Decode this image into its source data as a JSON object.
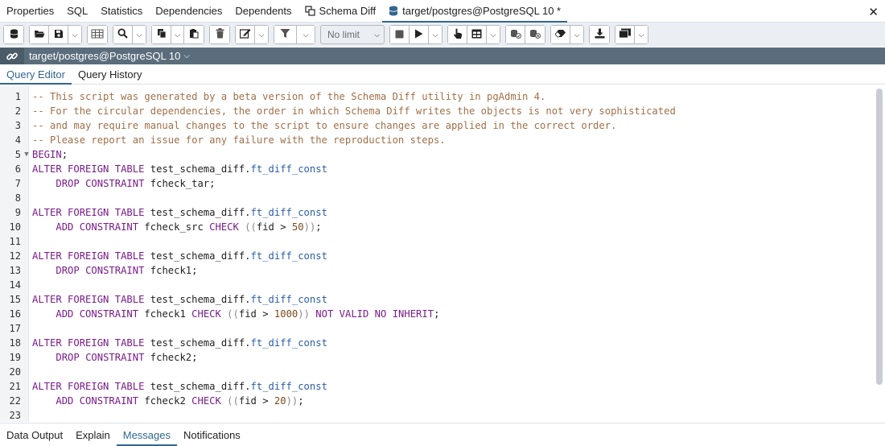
{
  "tabs": [
    {
      "label": "Properties"
    },
    {
      "label": "SQL"
    },
    {
      "label": "Statistics"
    },
    {
      "label": "Dependencies"
    },
    {
      "label": "Dependents"
    },
    {
      "label": "Schema Diff",
      "icon": "schema-diff-icon"
    },
    {
      "label": "target/postgres@PostgreSQL 10 *",
      "icon": "database-icon",
      "active": true
    }
  ],
  "close_glyph": "✕",
  "toolbar": {
    "limit_select": {
      "value": "No limit"
    }
  },
  "connection": {
    "label": "target/postgres@PostgreSQL 10",
    "icon": "connection-icon"
  },
  "subtabs": [
    {
      "label": "Query Editor",
      "active": true
    },
    {
      "label": "Query History"
    }
  ],
  "editor": {
    "lines": [
      {
        "n": "1",
        "text": "-- This script was generated by a beta version of the Schema Diff utility in pgAdmin 4."
      },
      {
        "n": "2",
        "text": "-- For the circular dependencies, the order in which Schema Diff writes the objects is not very sophisticated"
      },
      {
        "n": "3",
        "text": "-- and may require manual changes to the script to ensure changes are applied in the correct order."
      },
      {
        "n": "4",
        "text": "-- Please report an issue for any failure with the reproduction steps."
      },
      {
        "n": "5",
        "text": "BEGIN;"
      },
      {
        "n": "6",
        "text": "ALTER FOREIGN TABLE test_schema_diff.ft_diff_const"
      },
      {
        "n": "7",
        "text": "    DROP CONSTRAINT fcheck_tar;"
      },
      {
        "n": "8",
        "text": ""
      },
      {
        "n": "9",
        "text": "ALTER FOREIGN TABLE test_schema_diff.ft_diff_const"
      },
      {
        "n": "10",
        "text": "    ADD CONSTRAINT fcheck_src CHECK ((fid > 50));"
      },
      {
        "n": "11",
        "text": ""
      },
      {
        "n": "12",
        "text": "ALTER FOREIGN TABLE test_schema_diff.ft_diff_const"
      },
      {
        "n": "13",
        "text": "    DROP CONSTRAINT fcheck1;"
      },
      {
        "n": "14",
        "text": ""
      },
      {
        "n": "15",
        "text": "ALTER FOREIGN TABLE test_schema_diff.ft_diff_const"
      },
      {
        "n": "16",
        "text": "    ADD CONSTRAINT fcheck1 CHECK ((fid > 1000)) NOT VALID NO INHERIT;"
      },
      {
        "n": "17",
        "text": ""
      },
      {
        "n": "18",
        "text": "ALTER FOREIGN TABLE test_schema_diff.ft_diff_const"
      },
      {
        "n": "19",
        "text": "    DROP CONSTRAINT fcheck2;"
      },
      {
        "n": "20",
        "text": ""
      },
      {
        "n": "21",
        "text": "ALTER FOREIGN TABLE test_schema_diff.ft_diff_const"
      },
      {
        "n": "22",
        "text": "    ADD CONSTRAINT fcheck2 CHECK ((fid > 20));"
      },
      {
        "n": "23",
        "text": ""
      }
    ]
  },
  "bottom_tabs": [
    {
      "label": "Data Output"
    },
    {
      "label": "Explain"
    },
    {
      "label": "Messages",
      "active": true
    },
    {
      "label": "Notifications"
    }
  ],
  "colors": {
    "accent": "#326690",
    "connection_bar": "#5b6d7c",
    "comment": "#a0704a",
    "keyword": "#7a1b8c",
    "property": "#2b5ea7"
  }
}
